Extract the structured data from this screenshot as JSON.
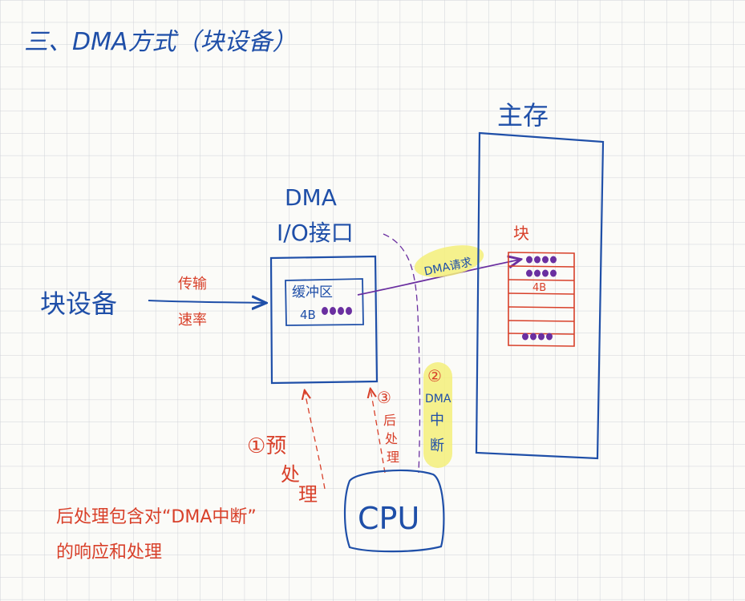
{
  "title": "三、DMA方式（块设备）",
  "block_device_label": "块设备",
  "transfer_rate_label_1": "传输",
  "transfer_rate_label_2": "速率",
  "dma_interface_label_1": "DMA",
  "dma_interface_label_2": "I/O接口",
  "buffer_label": "缓冲区",
  "buffer_size_label": "4B",
  "dma_request_label": "DMA请求",
  "main_memory_label": "主存",
  "block_label": "块",
  "block_size_label": "4B",
  "step1_label_1": "①预",
  "step1_label_2": "处",
  "step1_label_3": "理",
  "step3_label_1": "③",
  "step3_label_2": "后",
  "step3_label_3": "处",
  "step3_label_4": "理",
  "step2_label_1": "②",
  "step2_label_2": "DMA",
  "step2_label_3": "中",
  "step2_label_4": "断",
  "cpu_label": "CPU",
  "note_line_1": "后处理包含对“DMA中断”",
  "note_line_2": "的响应和处理",
  "colors": {
    "blue_ink": "#1f4fa8",
    "red_ink": "#d8402a",
    "purple_ink": "#6a2fa0",
    "highlight": "#f3ee7a",
    "grid": "#cfd2d8"
  }
}
